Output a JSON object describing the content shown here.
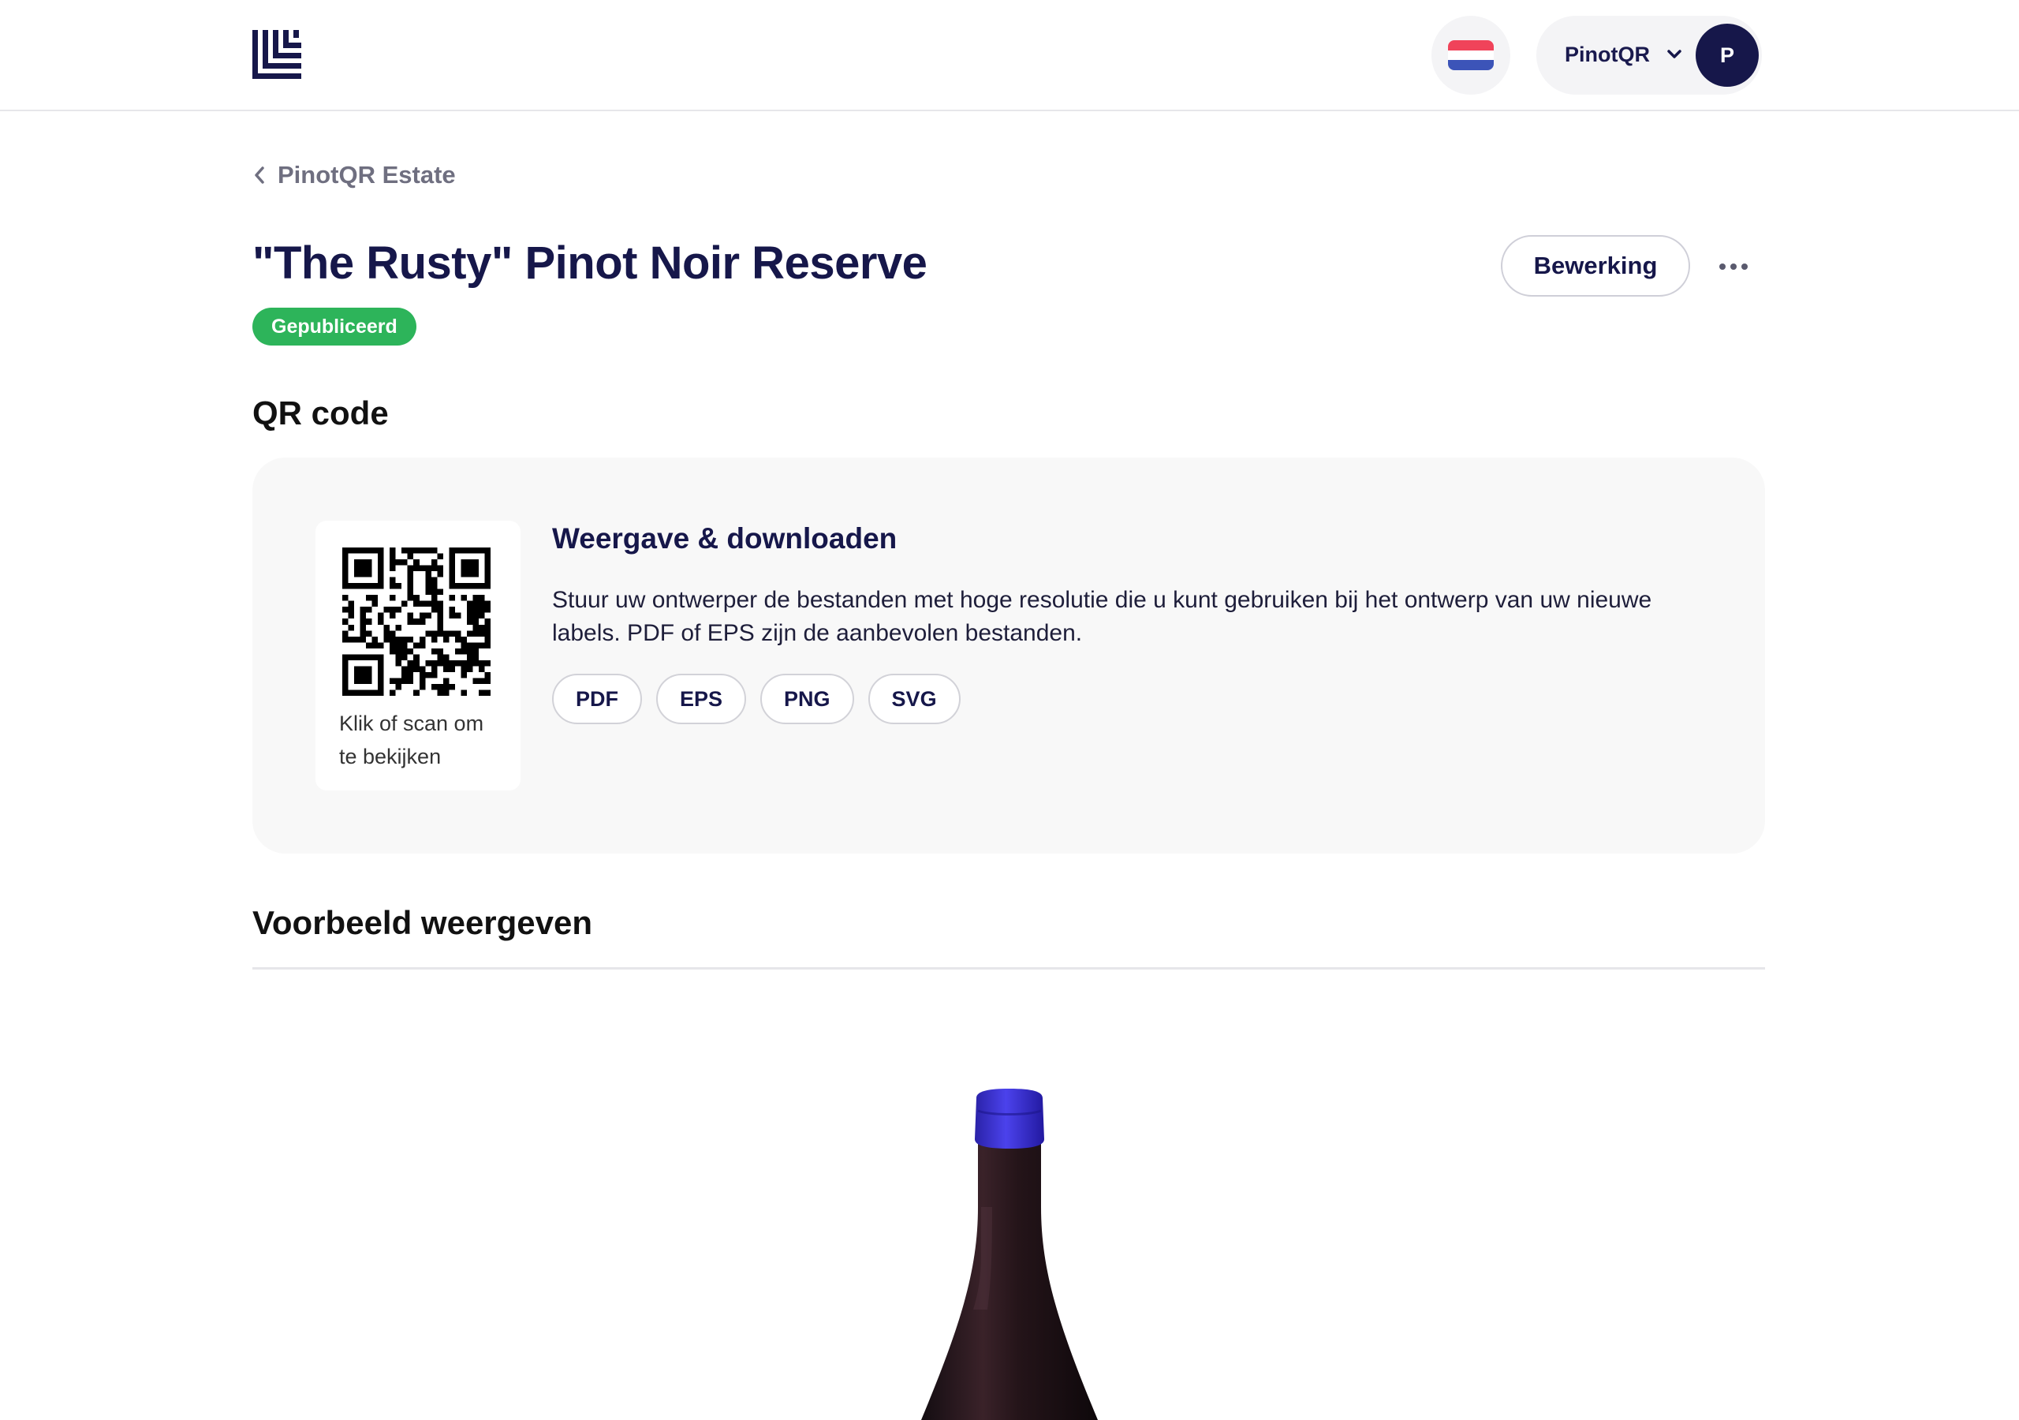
{
  "header": {
    "language_flag": "netherlands-flag-icon",
    "account_name": "PinotQR",
    "avatar_initial": "P"
  },
  "breadcrumb": {
    "back_label": "PinotQR Estate"
  },
  "product": {
    "title": "\"The Rusty\" Pinot Noir Reserve",
    "status": "Gepubliceerd",
    "edit_label": "Bewerking"
  },
  "qr_section": {
    "heading": "QR code",
    "caption": "Klik of scan om te bekijken",
    "download_title": "Weergave & downloaden",
    "download_description": "Stuur uw ontwerper de bestanden met hoge resolutie die u kunt gebruiken bij het ontwerp van uw nieuwe labels. PDF of EPS zijn de aanbevolen bestanden.",
    "formats": [
      "PDF",
      "EPS",
      "PNG",
      "SVG"
    ]
  },
  "preview_section": {
    "heading": "Voorbeeld weergeven"
  },
  "colors": {
    "navy": "#16174a",
    "published_green": "#2db45a",
    "panel_bg": "#f8f8f8",
    "capsule_blue": "#3a2fd6"
  }
}
